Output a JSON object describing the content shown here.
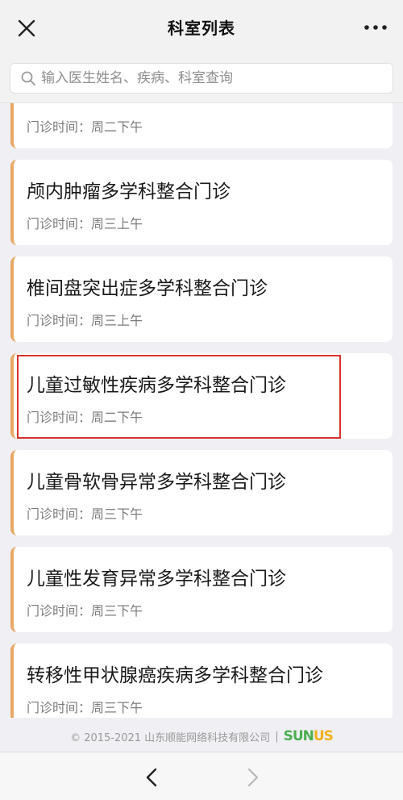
{
  "header": {
    "title": "科室列表",
    "close_icon": "close-icon",
    "more_icon": "more-icon"
  },
  "search": {
    "placeholder": "输入医生姓名、疾病、科室查询",
    "value": "",
    "icon": "search-icon"
  },
  "departments": [
    {
      "name": "",
      "time": "门诊时间：周二下午"
    },
    {
      "name": "颅内肿瘤多学科整合门诊",
      "time": "门诊时间：周三上午"
    },
    {
      "name": "椎间盘突出症多学科整合门诊",
      "time": "门诊时间：周三上午"
    },
    {
      "name": "儿童过敏性疾病多学科整合门诊",
      "time": "门诊时间：周二下午"
    },
    {
      "name": "儿童骨软骨异常多学科整合门诊",
      "time": "门诊时间：周三下午"
    },
    {
      "name": "儿童性发育异常多学科整合门诊",
      "time": "门诊时间：周三下午"
    },
    {
      "name": "转移性甲状腺癌疾病多学科整合门诊",
      "time": "门诊时间：周三下午"
    }
  ],
  "footer": {
    "copyright": "© 2015-2021 山东顺能网络科技有限公司",
    "separator": "|",
    "logo_part1": "SUN",
    "logo_part2": "US"
  },
  "colors": {
    "accent_border": "#e8a866",
    "highlight": "#d9312b",
    "logo_green": "#4caf50",
    "logo_yellow": "#f0b21b"
  },
  "nav": {
    "back_icon": "chevron-left-icon",
    "forward_icon": "chevron-right-icon"
  }
}
